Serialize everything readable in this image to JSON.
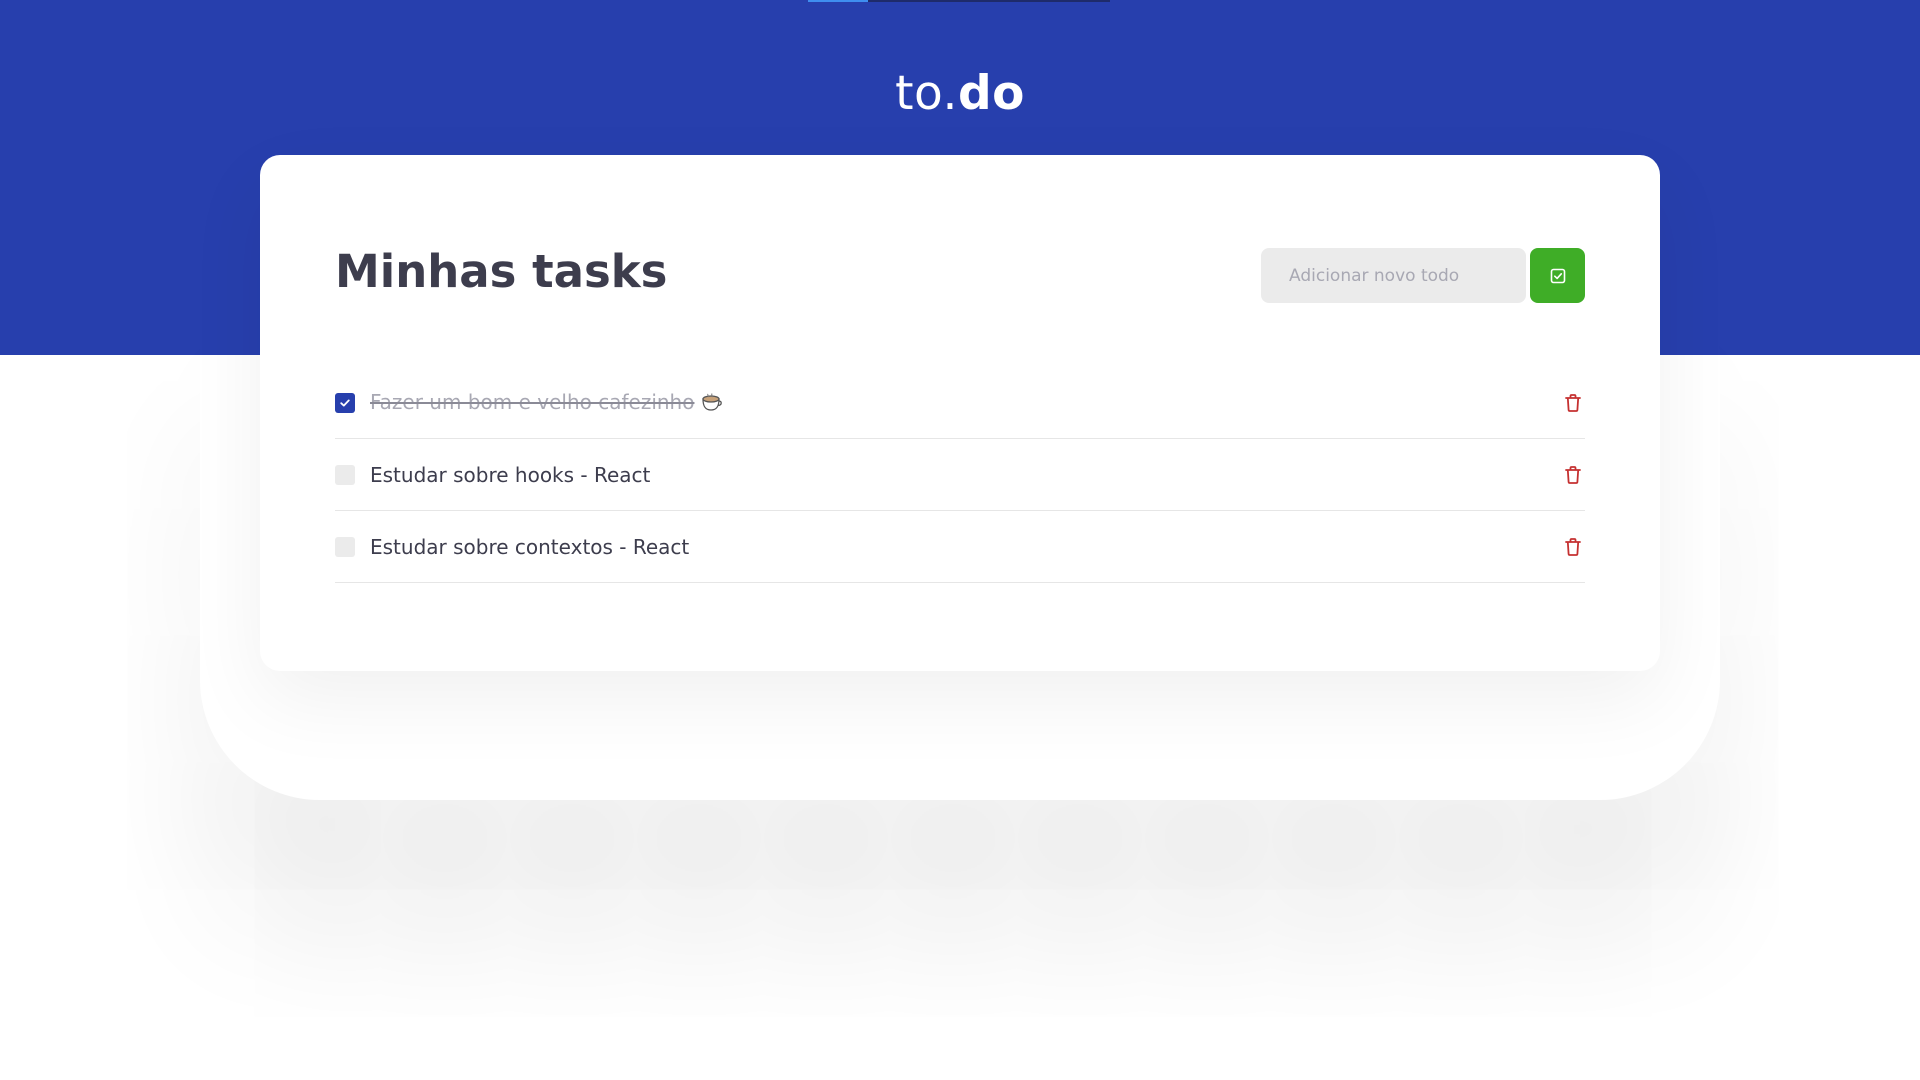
{
  "app": {
    "logo_light": "to.",
    "logo_bold": "do",
    "top_progress_percent": 20
  },
  "main": {
    "title": "Minhas tasks"
  },
  "add_form": {
    "input_value": "",
    "input_placeholder": "Adicionar novo todo",
    "submit_icon": "check-square-icon"
  },
  "tasks": [
    {
      "text": "Fazer um bom e velho cafezinho",
      "done": true,
      "emoji": "coffee-cup-icon",
      "delete_icon": "trash-icon"
    },
    {
      "text": "Estudar sobre hooks - React",
      "done": false,
      "delete_icon": "trash-icon"
    },
    {
      "text": "Estudar sobre contextos - React",
      "done": false,
      "delete_icon": "trash-icon"
    }
  ],
  "colors": {
    "header_bg": "#273fad",
    "accent_green": "#3fad27",
    "checkbox_checked": "#273fad",
    "delete_red": "#c53030",
    "title_text": "#3d3d4d"
  }
}
